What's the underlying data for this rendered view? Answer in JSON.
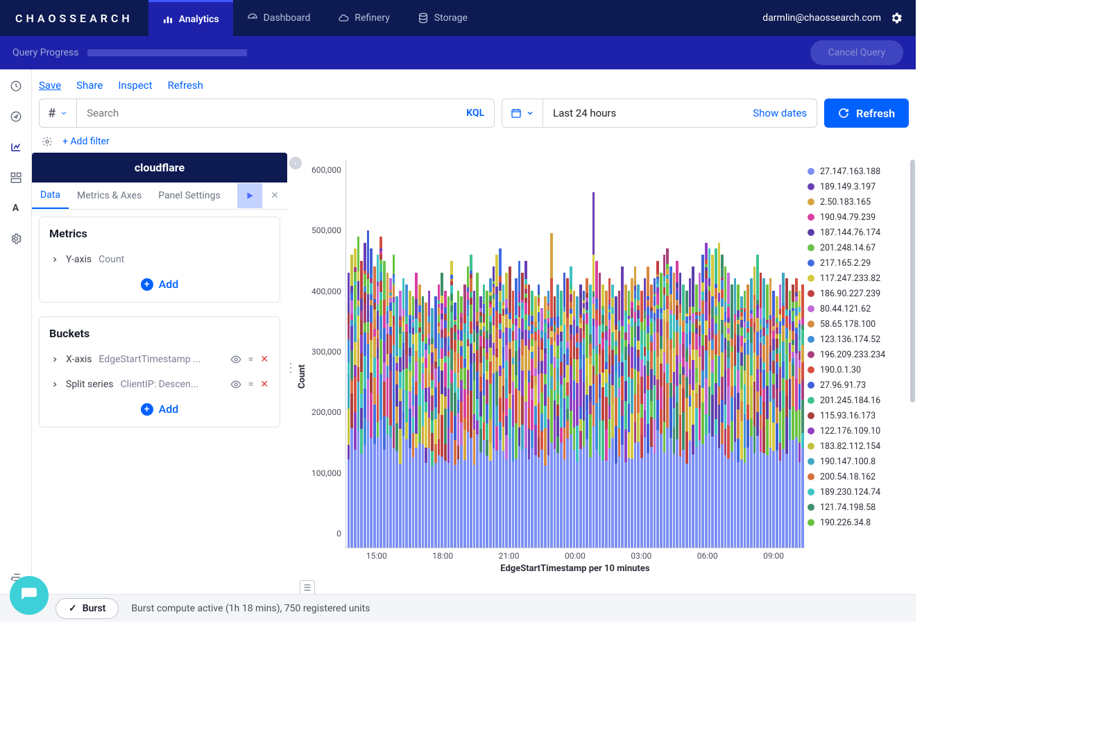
{
  "brand": "CHAOSSEARCH",
  "topnav": [
    {
      "label": "Analytics",
      "active": true,
      "icon": "chart-bar"
    },
    {
      "label": "Dashboard",
      "active": false,
      "icon": "gauge"
    },
    {
      "label": "Refinery",
      "active": false,
      "icon": "cloud"
    },
    {
      "label": "Storage",
      "active": false,
      "icon": "database"
    }
  ],
  "user_email": "darmlin@chaossearch.com",
  "progress": {
    "label": "Query Progress",
    "cancel": "Cancel Query"
  },
  "actions": {
    "save": "Save",
    "share": "Share",
    "inspect": "Inspect",
    "refresh": "Refresh"
  },
  "search": {
    "placeholder": "Search",
    "lang": "KQL"
  },
  "date": {
    "value": "Last 24 hours",
    "show": "Show dates"
  },
  "refresh_btn": "Refresh",
  "add_filter": "+ Add filter",
  "panel": {
    "title": "cloudflare",
    "tabs": [
      "Data",
      "Metrics & Axes",
      "Panel Settings"
    ],
    "metrics": {
      "heading": "Metrics",
      "rows": [
        {
          "label": "Y-axis",
          "value": "Count"
        }
      ],
      "add": "Add"
    },
    "buckets": {
      "heading": "Buckets",
      "rows": [
        {
          "label": "X-axis",
          "value": "EdgeStartTimestamp ..."
        },
        {
          "label": "Split series",
          "value": "ClientIP: Descen..."
        }
      ],
      "add": "Add"
    }
  },
  "chart_data": {
    "type": "bar",
    "title": "",
    "xlabel": "EdgeStartTimestamp per 10 minutes",
    "ylabel": "Count",
    "ylim": [
      0,
      650000
    ],
    "yticks": [
      "600,000",
      "500,000",
      "400,000",
      "300,000",
      "200,000",
      "100,000",
      "0"
    ],
    "xticks": [
      "15:00",
      "18:00",
      "21:00",
      "00:00",
      "03:00",
      "06:00",
      "09:00"
    ],
    "series": [
      {
        "name": "27.147.163.188",
        "color": "#7b8ff5"
      },
      {
        "name": "189.149.3.197",
        "color": "#6a3fb5"
      },
      {
        "name": "2.50.183.165",
        "color": "#d6a340"
      },
      {
        "name": "190.94.79.239",
        "color": "#d83fa1"
      },
      {
        "name": "187.144.76.174",
        "color": "#5a3fa8"
      },
      {
        "name": "201.248.14.67",
        "color": "#6ac24a"
      },
      {
        "name": "217.165.2.29",
        "color": "#3f6de0"
      },
      {
        "name": "117.247.233.82",
        "color": "#d6c93f"
      },
      {
        "name": "186.90.227.239",
        "color": "#c23f3f"
      },
      {
        "name": "80.44.121.62",
        "color": "#c26ad6"
      },
      {
        "name": "58.65.178.100",
        "color": "#d68a3f"
      },
      {
        "name": "123.136.174.52",
        "color": "#3f8fd6"
      },
      {
        "name": "196.209.233.234",
        "color": "#a83f7b"
      },
      {
        "name": "190.0.1.30",
        "color": "#d6503f"
      },
      {
        "name": "27.96.91.73",
        "color": "#3f5fd6"
      },
      {
        "name": "201.245.184.16",
        "color": "#3fc28f"
      },
      {
        "name": "115.93.16.173",
        "color": "#a83f3f"
      },
      {
        "name": "122.176.109.10",
        "color": "#8f3fc2"
      },
      {
        "name": "183.82.112.154",
        "color": "#c2c23f"
      },
      {
        "name": "190.147.100.8",
        "color": "#3fa8c2"
      },
      {
        "name": "200.54.18.162",
        "color": "#d6703f"
      },
      {
        "name": "189.230.124.74",
        "color": "#3fc2c2"
      },
      {
        "name": "121.74.198.58",
        "color": "#3f8f6a"
      },
      {
        "name": "190.226.34.8",
        "color": "#6ac23f"
      }
    ],
    "totals_sample": [
      460,
      490,
      500,
      520,
      480,
      510,
      530,
      500,
      470,
      490,
      520,
      480,
      460,
      450,
      490,
      420,
      430,
      450,
      440,
      430,
      420,
      460,
      440,
      420,
      410,
      430,
      400,
      420,
      440,
      460,
      430,
      420,
      480,
      410,
      430,
      420,
      440,
      470,
      490,
      430,
      460,
      420,
      440,
      430,
      450,
      470,
      490,
      500,
      440,
      460,
      470,
      430,
      450,
      480,
      460,
      480,
      440,
      430,
      420,
      440,
      400,
      420,
      430,
      450,
      420,
      440,
      430,
      460,
      450,
      470,
      430,
      420,
      440,
      430,
      450,
      440,
      490,
      480,
      460,
      440,
      430,
      450,
      440,
      420,
      430,
      470,
      440,
      430,
      450,
      470,
      440,
      430,
      450,
      470,
      440,
      450,
      480,
      460,
      490,
      500,
      470,
      460,
      480,
      460,
      440,
      430,
      450,
      470,
      440,
      460,
      490,
      510,
      500,
      490,
      500,
      510,
      490,
      470,
      460,
      440,
      450,
      440,
      420,
      430,
      440,
      450,
      470,
      490,
      460,
      450,
      440,
      450,
      430,
      420,
      440,
      460,
      450,
      430,
      440,
      450,
      430,
      440
    ]
  },
  "footer": {
    "burst": "Burst",
    "status": "Burst compute active (1h 18 mins), 750 registered units"
  }
}
